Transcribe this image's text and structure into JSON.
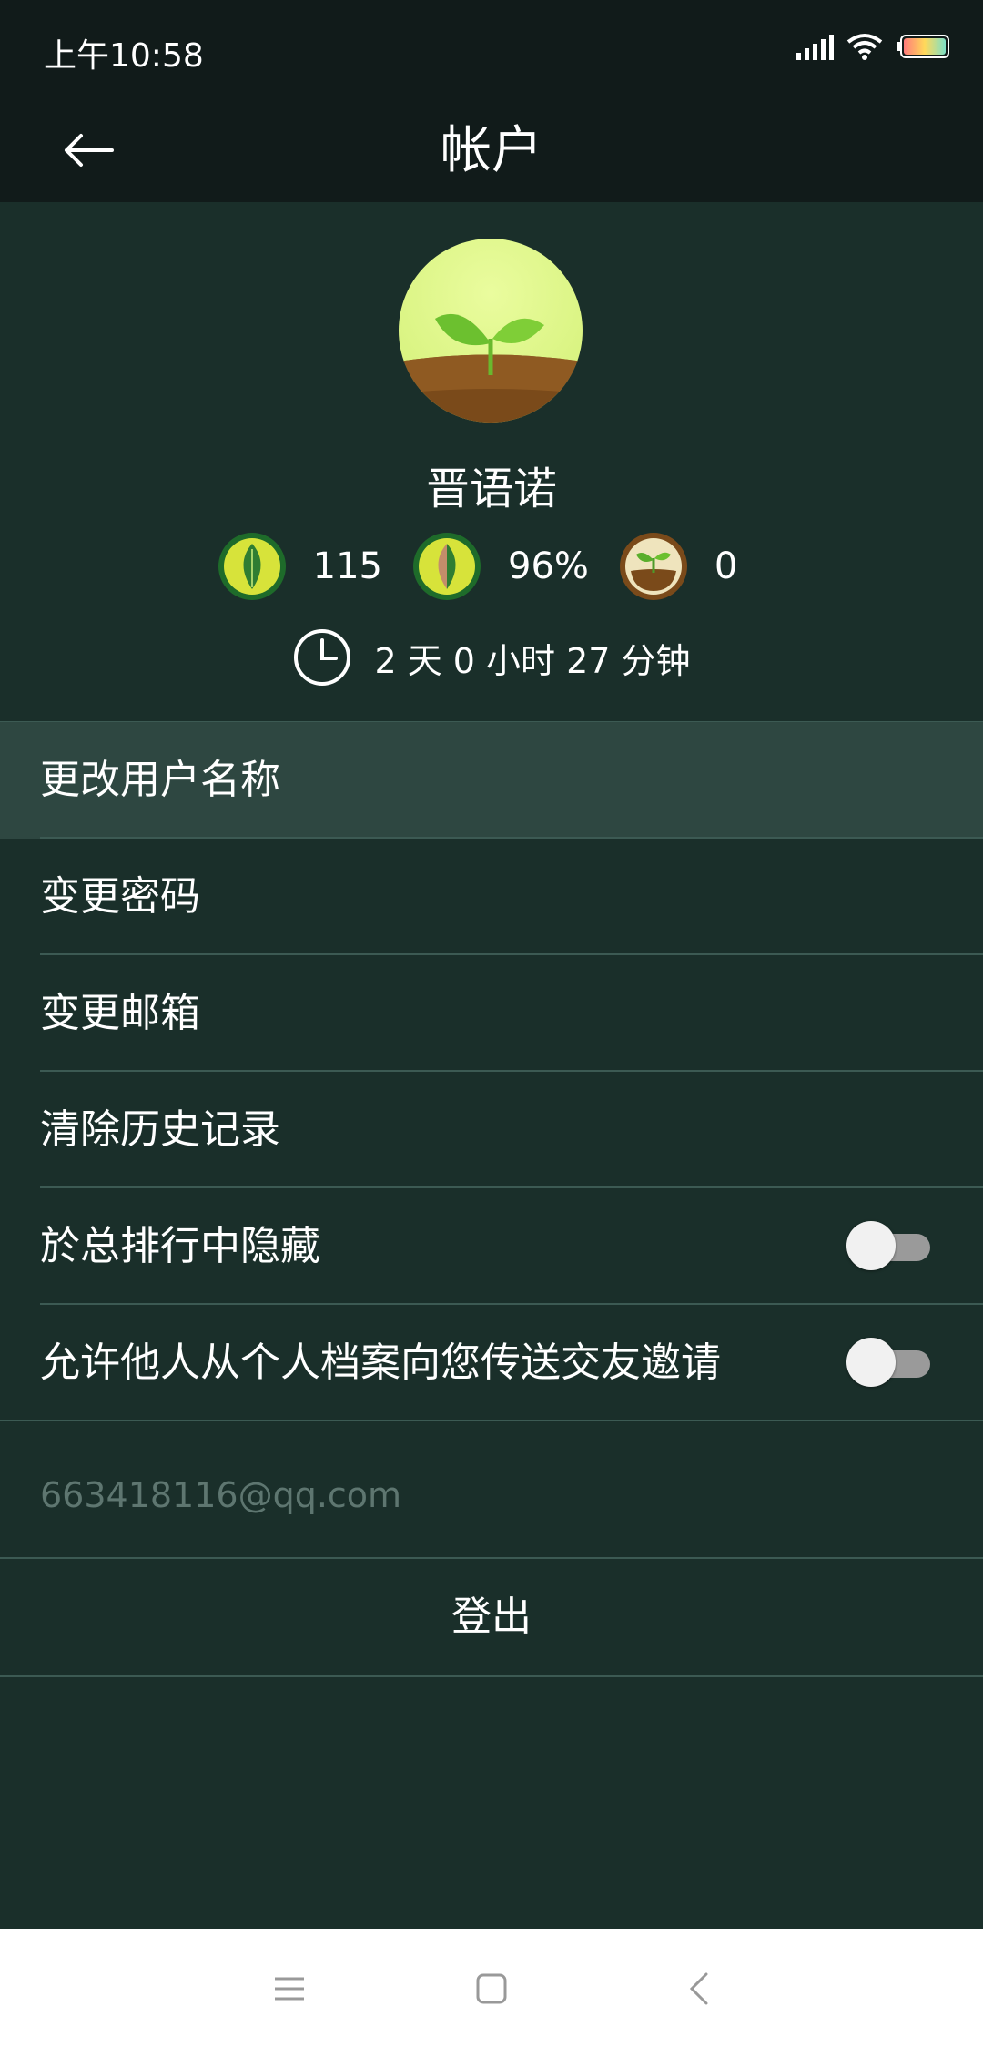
{
  "status_bar": {
    "time": "上午10:58",
    "icons": [
      "signal-icon",
      "wifi-icon",
      "battery-icon"
    ]
  },
  "header": {
    "title": "帐户",
    "back_icon": "arrow-left-icon"
  },
  "profile": {
    "name": "晋语诺",
    "stats": [
      {
        "icon": "green-leaf-badge-icon",
        "value": "115"
      },
      {
        "icon": "half-leaf-badge-icon",
        "value": "96%"
      },
      {
        "icon": "sprout-badge-icon",
        "value": "0"
      }
    ],
    "total_time": "2 天 0 小时 27 分钟",
    "time_icon": "clock-icon"
  },
  "menu": {
    "items": [
      {
        "label": "更改用户名称"
      },
      {
        "label": "变更密码"
      },
      {
        "label": "变更邮箱"
      },
      {
        "label": "清除历史记录"
      },
      {
        "label": "於总排行中隐藏",
        "toggle": false
      },
      {
        "label": "允许他人从个人档案向您传送交友邀请",
        "toggle": false
      }
    ]
  },
  "account": {
    "email": "663418116@qq.com",
    "logout_label": "登出"
  },
  "nav": {
    "icons": [
      "menu-icon",
      "home-icon",
      "back-icon"
    ]
  },
  "colors": {
    "background": "#1a2f2a",
    "app_bar": "#111b1a",
    "divider": "#3c5a53",
    "highlight": "#2e4741"
  }
}
